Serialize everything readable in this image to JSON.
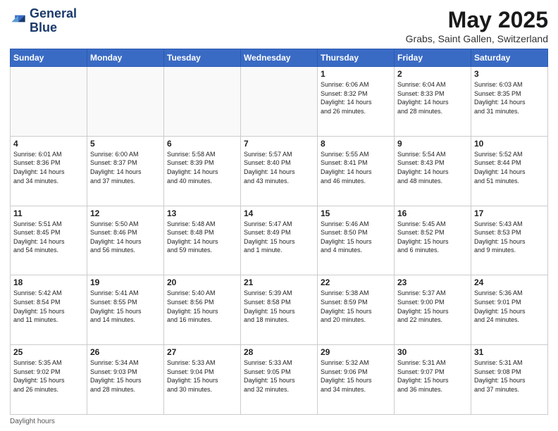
{
  "logo": {
    "line1": "General",
    "line2": "Blue"
  },
  "title": "May 2025",
  "subtitle": "Grabs, Saint Gallen, Switzerland",
  "days_header": [
    "Sunday",
    "Monday",
    "Tuesday",
    "Wednesday",
    "Thursday",
    "Friday",
    "Saturday"
  ],
  "footer_label": "Daylight hours",
  "weeks": [
    [
      {
        "day": "",
        "info": ""
      },
      {
        "day": "",
        "info": ""
      },
      {
        "day": "",
        "info": ""
      },
      {
        "day": "",
        "info": ""
      },
      {
        "day": "1",
        "info": "Sunrise: 6:06 AM\nSunset: 8:32 PM\nDaylight: 14 hours\nand 26 minutes."
      },
      {
        "day": "2",
        "info": "Sunrise: 6:04 AM\nSunset: 8:33 PM\nDaylight: 14 hours\nand 28 minutes."
      },
      {
        "day": "3",
        "info": "Sunrise: 6:03 AM\nSunset: 8:35 PM\nDaylight: 14 hours\nand 31 minutes."
      }
    ],
    [
      {
        "day": "4",
        "info": "Sunrise: 6:01 AM\nSunset: 8:36 PM\nDaylight: 14 hours\nand 34 minutes."
      },
      {
        "day": "5",
        "info": "Sunrise: 6:00 AM\nSunset: 8:37 PM\nDaylight: 14 hours\nand 37 minutes."
      },
      {
        "day": "6",
        "info": "Sunrise: 5:58 AM\nSunset: 8:39 PM\nDaylight: 14 hours\nand 40 minutes."
      },
      {
        "day": "7",
        "info": "Sunrise: 5:57 AM\nSunset: 8:40 PM\nDaylight: 14 hours\nand 43 minutes."
      },
      {
        "day": "8",
        "info": "Sunrise: 5:55 AM\nSunset: 8:41 PM\nDaylight: 14 hours\nand 46 minutes."
      },
      {
        "day": "9",
        "info": "Sunrise: 5:54 AM\nSunset: 8:43 PM\nDaylight: 14 hours\nand 48 minutes."
      },
      {
        "day": "10",
        "info": "Sunrise: 5:52 AM\nSunset: 8:44 PM\nDaylight: 14 hours\nand 51 minutes."
      }
    ],
    [
      {
        "day": "11",
        "info": "Sunrise: 5:51 AM\nSunset: 8:45 PM\nDaylight: 14 hours\nand 54 minutes."
      },
      {
        "day": "12",
        "info": "Sunrise: 5:50 AM\nSunset: 8:46 PM\nDaylight: 14 hours\nand 56 minutes."
      },
      {
        "day": "13",
        "info": "Sunrise: 5:48 AM\nSunset: 8:48 PM\nDaylight: 14 hours\nand 59 minutes."
      },
      {
        "day": "14",
        "info": "Sunrise: 5:47 AM\nSunset: 8:49 PM\nDaylight: 15 hours\nand 1 minute."
      },
      {
        "day": "15",
        "info": "Sunrise: 5:46 AM\nSunset: 8:50 PM\nDaylight: 15 hours\nand 4 minutes."
      },
      {
        "day": "16",
        "info": "Sunrise: 5:45 AM\nSunset: 8:52 PM\nDaylight: 15 hours\nand 6 minutes."
      },
      {
        "day": "17",
        "info": "Sunrise: 5:43 AM\nSunset: 8:53 PM\nDaylight: 15 hours\nand 9 minutes."
      }
    ],
    [
      {
        "day": "18",
        "info": "Sunrise: 5:42 AM\nSunset: 8:54 PM\nDaylight: 15 hours\nand 11 minutes."
      },
      {
        "day": "19",
        "info": "Sunrise: 5:41 AM\nSunset: 8:55 PM\nDaylight: 15 hours\nand 14 minutes."
      },
      {
        "day": "20",
        "info": "Sunrise: 5:40 AM\nSunset: 8:56 PM\nDaylight: 15 hours\nand 16 minutes."
      },
      {
        "day": "21",
        "info": "Sunrise: 5:39 AM\nSunset: 8:58 PM\nDaylight: 15 hours\nand 18 minutes."
      },
      {
        "day": "22",
        "info": "Sunrise: 5:38 AM\nSunset: 8:59 PM\nDaylight: 15 hours\nand 20 minutes."
      },
      {
        "day": "23",
        "info": "Sunrise: 5:37 AM\nSunset: 9:00 PM\nDaylight: 15 hours\nand 22 minutes."
      },
      {
        "day": "24",
        "info": "Sunrise: 5:36 AM\nSunset: 9:01 PM\nDaylight: 15 hours\nand 24 minutes."
      }
    ],
    [
      {
        "day": "25",
        "info": "Sunrise: 5:35 AM\nSunset: 9:02 PM\nDaylight: 15 hours\nand 26 minutes."
      },
      {
        "day": "26",
        "info": "Sunrise: 5:34 AM\nSunset: 9:03 PM\nDaylight: 15 hours\nand 28 minutes."
      },
      {
        "day": "27",
        "info": "Sunrise: 5:33 AM\nSunset: 9:04 PM\nDaylight: 15 hours\nand 30 minutes."
      },
      {
        "day": "28",
        "info": "Sunrise: 5:33 AM\nSunset: 9:05 PM\nDaylight: 15 hours\nand 32 minutes."
      },
      {
        "day": "29",
        "info": "Sunrise: 5:32 AM\nSunset: 9:06 PM\nDaylight: 15 hours\nand 34 minutes."
      },
      {
        "day": "30",
        "info": "Sunrise: 5:31 AM\nSunset: 9:07 PM\nDaylight: 15 hours\nand 36 minutes."
      },
      {
        "day": "31",
        "info": "Sunrise: 5:31 AM\nSunset: 9:08 PM\nDaylight: 15 hours\nand 37 minutes."
      }
    ]
  ]
}
